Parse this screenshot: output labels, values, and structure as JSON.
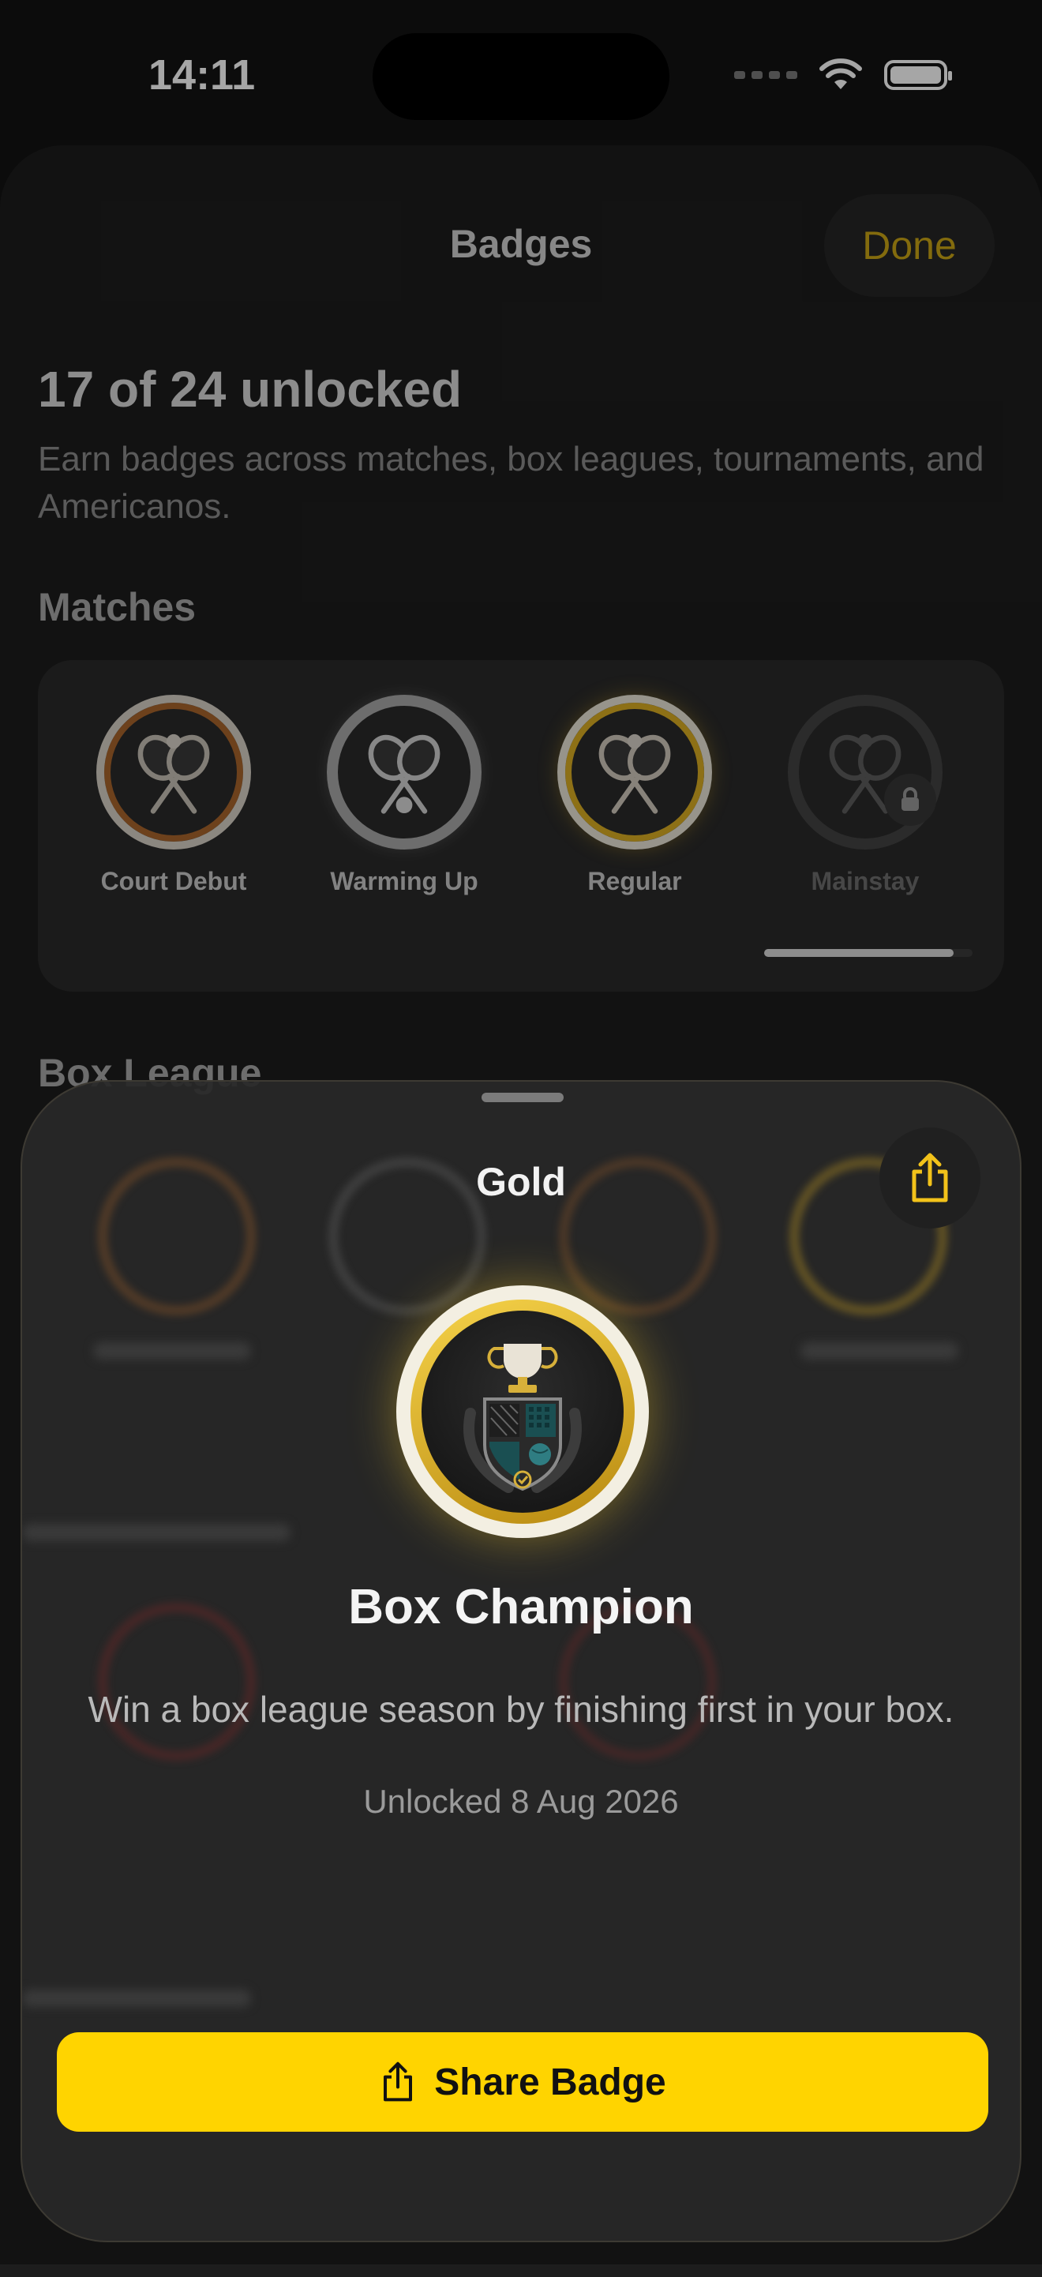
{
  "status_bar": {
    "time": "14:11"
  },
  "nav": {
    "title": "Badges",
    "done_label": "Done"
  },
  "summary": {
    "title": "17 of 24 unlocked",
    "subtitle": "Earn badges across matches, box leagues, tournaments, and Americanos."
  },
  "sections": {
    "matches": {
      "heading": "Matches",
      "badges": [
        {
          "label": "Court Debut",
          "tier": "bronze",
          "locked": false
        },
        {
          "label": "Warming Up",
          "tier": "silver",
          "locked": false
        },
        {
          "label": "Regular",
          "tier": "gold",
          "locked": false
        },
        {
          "label": "Mainstay",
          "tier": "none",
          "locked": true
        }
      ],
      "scroll_position": 0.9
    },
    "box_league": {
      "heading": "Box League"
    }
  },
  "modal": {
    "tier": "Gold",
    "badge_name": "Box Champion",
    "description": "Win a box league season by finishing first in your box.",
    "unlocked": "Unlocked 8 Aug 2026",
    "share_label": "Share Badge"
  },
  "colors": {
    "accent_yellow": "#ffd400",
    "done_text": "#c9a514",
    "bronze": "#a8652c",
    "silver": "#b9b9b9",
    "gold": "#d9ac22",
    "teal": "#1a4f52"
  },
  "icons": [
    "wifi-icon",
    "battery-icon",
    "padel-rackets-icon",
    "lock-icon",
    "share-icon",
    "trophy-crest-icon"
  ]
}
